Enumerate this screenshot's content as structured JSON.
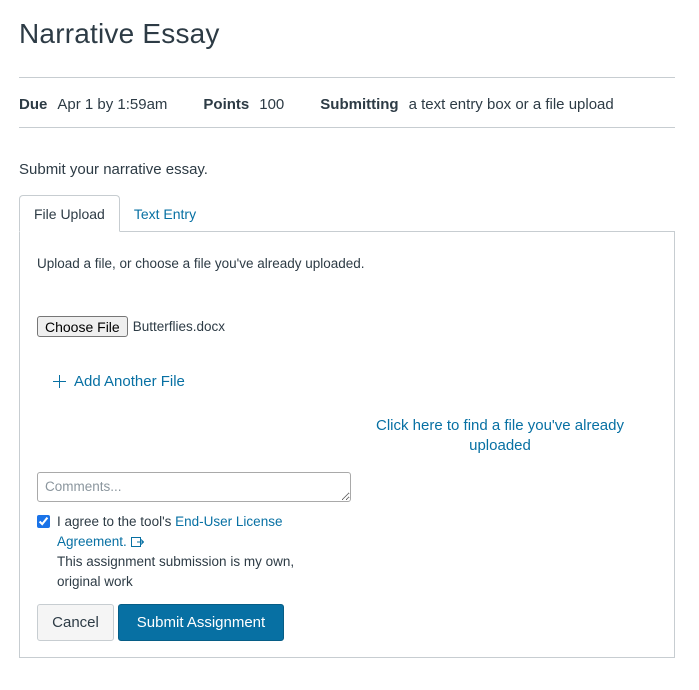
{
  "assignment": {
    "title": "Narrative Essay",
    "due_label": "Due",
    "due_value": "Apr 1 by 1:59am",
    "points_label": "Points",
    "points_value": "100",
    "submitting_label": "Submitting",
    "submitting_value": "a text entry box or a file upload",
    "instructions": "Submit your narrative essay."
  },
  "tabs": [
    {
      "label": "File Upload",
      "active": true
    },
    {
      "label": "Text Entry",
      "active": false
    }
  ],
  "upload": {
    "prompt": "Upload a file, or choose a file you've already uploaded.",
    "choose_file_label": "Choose File",
    "selected_file": "Butterflies.docx",
    "add_another_label": "Add Another File",
    "find_uploaded_label": "Click here to find a file you've already uploaded",
    "comments_placeholder": "Comments...",
    "agree_prefix": "I agree to the tool's ",
    "eula_link": "End-User License Agreement.",
    "agree_note": "This assignment submission is my own, original work",
    "agree_checked": true
  },
  "buttons": {
    "cancel": "Cancel",
    "submit": "Submit Assignment"
  },
  "colors": {
    "link": "#0770a3",
    "primary": "#0770a3",
    "text": "#2d3b45",
    "border": "#c7cdd1"
  },
  "icons": {
    "add": "plus-icon",
    "external_link": "external-link-icon"
  }
}
